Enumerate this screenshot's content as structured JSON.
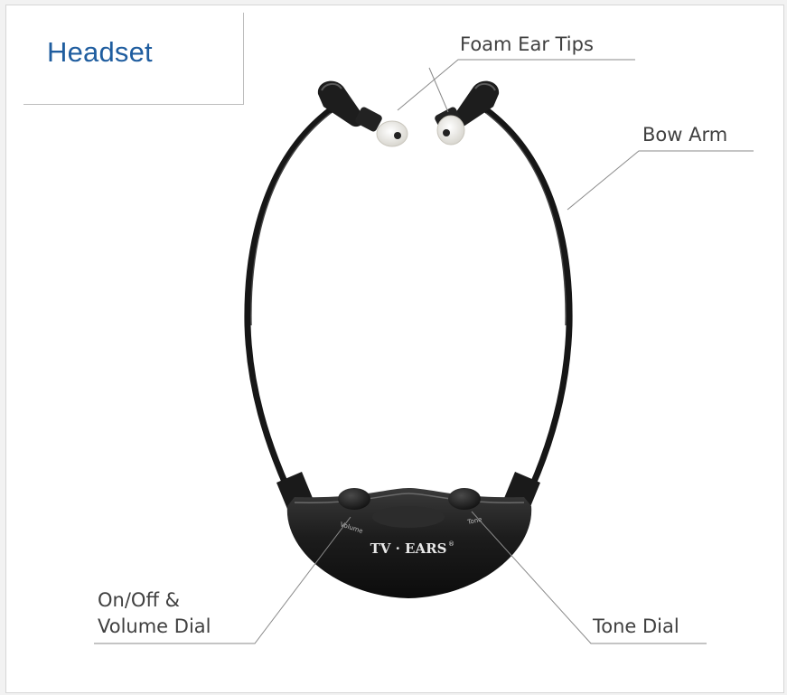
{
  "title": "Headset",
  "labels": {
    "foam_ear_tips": "Foam Ear Tips",
    "bow_arm": "Bow Arm",
    "volume_line1": "On/Off &",
    "volume_line2": "Volume Dial",
    "tone_dial": "Tone Dial"
  },
  "device": {
    "brand": "TV · EARS",
    "registered_mark": "®",
    "volume_marking": "Volume",
    "tone_marking": "Tone"
  },
  "colors": {
    "title": "#1f5d9f",
    "label_text": "#404040",
    "leader_line": "#8a8a8a",
    "headset_body": "#1a1a1a",
    "ear_tip": "#eceae4"
  }
}
